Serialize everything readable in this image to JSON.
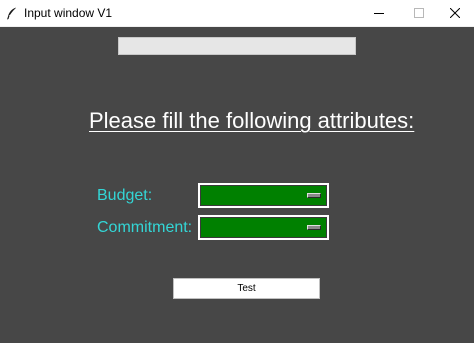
{
  "window": {
    "title": "Input window V1",
    "background_color": "#474747",
    "icons": {
      "app": "feather-icon",
      "minimize": "minimize-icon",
      "maximize": "maximize-icon",
      "close": "close-icon"
    }
  },
  "top_entry": {
    "value": ""
  },
  "heading": "Please fill the following attributes:",
  "fields": [
    {
      "label": "Budget:",
      "value": "",
      "widget_color": "#008000"
    },
    {
      "label": "Commitment:",
      "value": "",
      "widget_color": "#008000"
    }
  ],
  "label_color": "#33d6d6",
  "test_button": {
    "label": "Test"
  }
}
